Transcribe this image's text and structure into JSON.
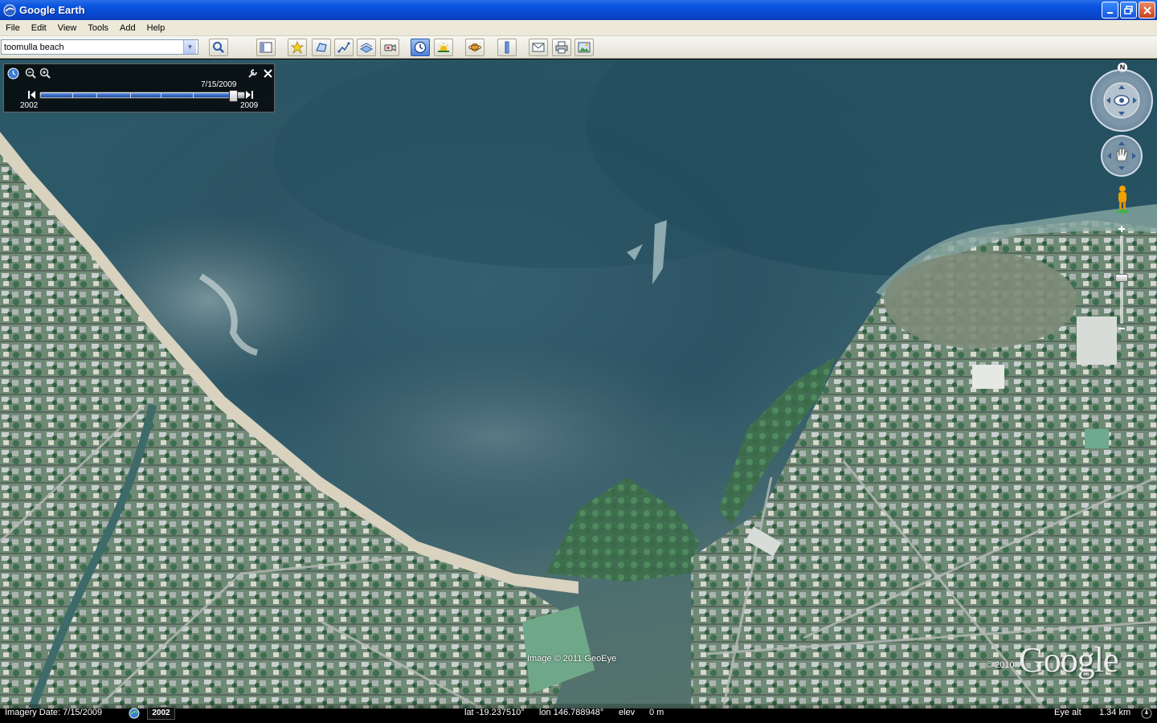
{
  "window": {
    "title": "Google Earth"
  },
  "menu": [
    "File",
    "Edit",
    "View",
    "Tools",
    "Add",
    "Help"
  ],
  "search": {
    "value": "toomulla beach",
    "placeholder": ""
  },
  "toolbar_icons": [
    "search-icon",
    "sidebar-toggle-icon",
    "placemark-icon",
    "polygon-icon",
    "path-icon",
    "image-overlay-icon",
    "record-tour-icon",
    "historical-imagery-icon",
    "sunlight-icon",
    "planet-icon",
    "ruler-icon",
    "email-icon",
    "print-icon",
    "save-image-icon"
  ],
  "time_slider": {
    "current_date": "7/15/2009",
    "start_year": "2002",
    "end_year": "2009",
    "position": 0.95
  },
  "map": {
    "copyright_imagery": "Image © 2011 GeoEye",
    "copyright_year": "© 2010",
    "logo": "Google"
  },
  "status": {
    "imagery_date": "Imagery Date: 7/15/2009",
    "date_chip": "2002",
    "lat": "lat  -19.237510°",
    "lon": "lon  146.788948°",
    "elev": "elev",
    "elev_value": "0 m",
    "eye_alt_label": "Eye alt",
    "eye_alt_value": "1.34 km"
  },
  "nav": {
    "north_label": "N"
  },
  "colors": {
    "titlebar": "#0a55e0",
    "sea": "#2f5c6c",
    "sand": "#d8d2bf"
  }
}
